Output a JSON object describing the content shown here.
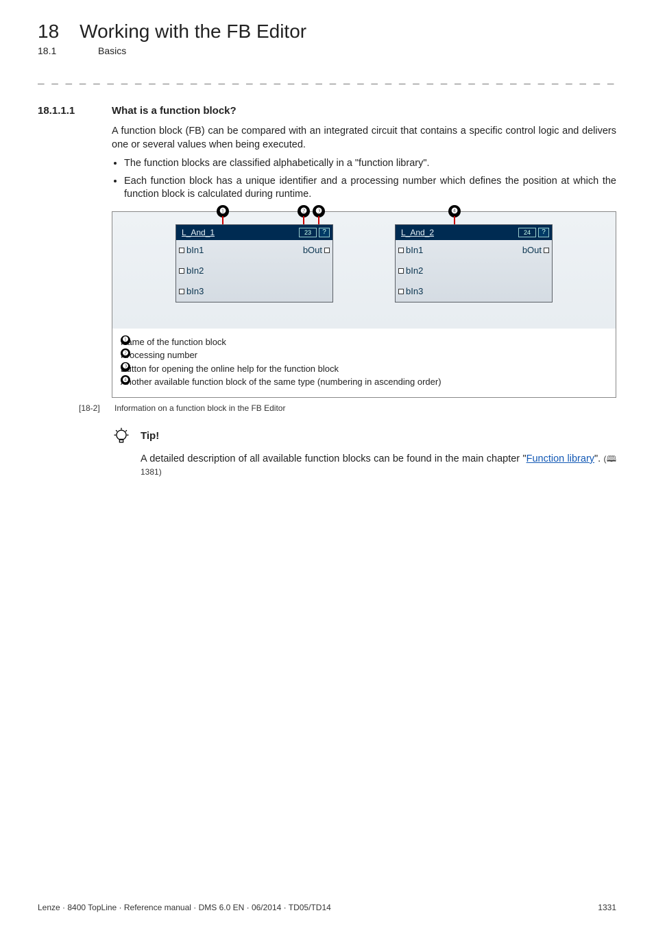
{
  "header": {
    "chapter_num": "18",
    "chapter_title": "Working with the FB Editor",
    "sub_num": "18.1",
    "sub_title": "Basics"
  },
  "section": {
    "num": "18.1.1.1",
    "title": "What is a function block?",
    "para": "A function block (FB) can be compared with an integrated circuit that contains a specific control logic and delivers one or several values when being executed.",
    "bullets": [
      "The function blocks are classified alphabetically in a \"function library\".",
      "Each function block has a unique identifier and a processing number which defines the position at which the function block is calculated during runtime."
    ]
  },
  "figure": {
    "fb1": {
      "name": "L_And_1",
      "proc": "23",
      "help": "?",
      "in1": "bIn1",
      "in2": "bIn2",
      "in3": "bIn3",
      "out": "bOut"
    },
    "fb2": {
      "name": "L_And_2",
      "proc": "24",
      "help": "?",
      "in1": "bIn1",
      "in2": "bIn2",
      "in3": "bIn3",
      "out": "bOut"
    },
    "callouts": {
      "c1": "Name of the function block",
      "c2": "Processing number",
      "c3": "Button for opening the online help for the function block",
      "c4": "Another available function block of the same type (numbering in ascending order)"
    },
    "label_num": "[18-2]",
    "label_text": "Information on a function block in the FB Editor"
  },
  "tip": {
    "title": "Tip!",
    "body_prefix": "A detailed description of all available function blocks can be found in the main chapter \"",
    "link_text": "Function library",
    "body_suffix": "\".",
    "page_ref": "1381"
  },
  "footer": {
    "left": "Lenze · 8400 TopLine · Reference manual · DMS 6.0 EN · 06/2014 · TD05/TD14",
    "right": "1331"
  }
}
